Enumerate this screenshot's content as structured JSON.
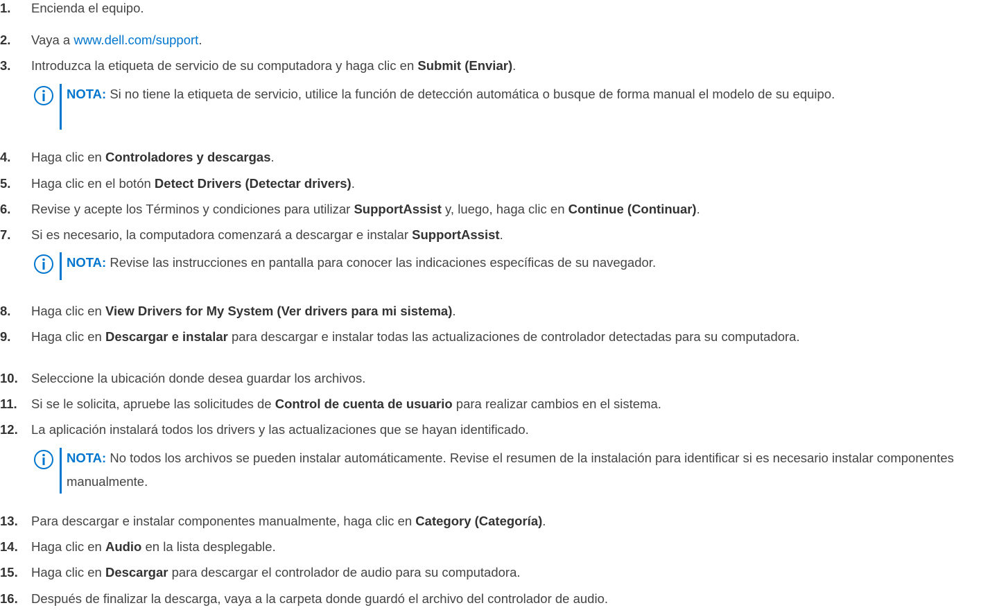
{
  "steps": [
    {
      "num": "1.",
      "text": "Encienda el equipo."
    },
    {
      "num": "2.",
      "pre": "Vaya a ",
      "link": "www.dell.com/support",
      "post": "."
    },
    {
      "num": "3.",
      "pre": "Introduzca la etiqueta de servicio de su computadora y haga clic en ",
      "bold": "Submit (Enviar)",
      "post": "."
    },
    {
      "num": "4.",
      "pre": "Haga clic en ",
      "bold": "Controladores y descargas",
      "post": "."
    },
    {
      "num": "5.",
      "pre": "Haga clic en el botón ",
      "bold": "Detect Drivers (Detectar drivers)",
      "post": "."
    },
    {
      "num": "6.",
      "pre": "Revise y acepte los Términos y condiciones para utilizar ",
      "bold": "SupportAssist",
      "mid": " y, luego, haga clic en ",
      "bold2": "Continue (Continuar)",
      "post": "."
    },
    {
      "num": "7.",
      "pre": "Si es necesario, la computadora comenzará a descargar e instalar ",
      "bold": "SupportAssist",
      "post": "."
    },
    {
      "num": "8.",
      "pre": "Haga clic en ",
      "bold": "View Drivers for My System (Ver drivers para mi sistema)",
      "post": "."
    },
    {
      "num": "9.",
      "pre": "Haga clic en ",
      "bold": "Descargar e instalar",
      "post": " para descargar e instalar todas las actualizaciones de controlador detectadas para su computadora."
    },
    {
      "num": "10.",
      "text": "Seleccione la ubicación donde desea guardar los archivos."
    },
    {
      "num": "11.",
      "pre": "Si se le solicita, apruebe las solicitudes de ",
      "bold": "Control de cuenta de usuario",
      "post": " para realizar cambios en el sistema."
    },
    {
      "num": "12.",
      "text": "La aplicación instalará todos los drivers y las actualizaciones que se hayan identificado."
    },
    {
      "num": "13.",
      "pre": "Para descargar e instalar componentes manualmente, haga clic en ",
      "bold": "Category (Categoría)",
      "post": "."
    },
    {
      "num": "14.",
      "pre": "Haga clic en ",
      "bold": "Audio",
      "post": " en la lista desplegable."
    },
    {
      "num": "15.",
      "pre": "Haga clic en ",
      "bold": "Descargar",
      "post": " para descargar el controlador de audio para su computadora."
    },
    {
      "num": "16.",
      "text": "Después de finalizar la descarga, vaya a la carpeta donde guardó el archivo del controlador de audio."
    }
  ],
  "notes": [
    {
      "label": "NOTA:",
      "text": " Si no tiene la etiqueta de servicio, utilice la función de detección automática o busque de forma manual el modelo de su equipo.",
      "icon": "info-icon"
    },
    {
      "label": "NOTA:",
      "text": " Revise las instrucciones en pantalla para conocer las indicaciones específicas de su navegador.",
      "icon": "info-icon"
    },
    {
      "label": "NOTA:",
      "text": " No todos los archivos se pueden instalar automáticamente. Revise el resumen de la instalación para identificar si es necesario instalar componentes manualmente.",
      "icon": "info-icon"
    }
  ],
  "colors": {
    "accent": "#0076ce",
    "text": "#444444"
  }
}
